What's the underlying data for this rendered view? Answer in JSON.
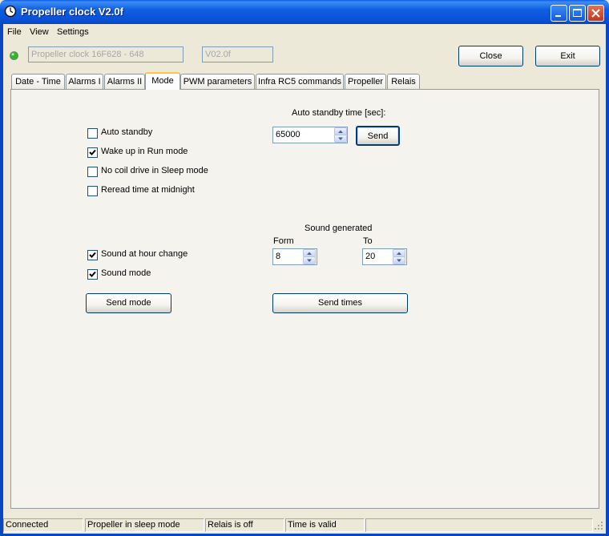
{
  "window": {
    "title": "Propeller clock V2.0f"
  },
  "menu": [
    "File",
    "View",
    "Settings"
  ],
  "header": {
    "status_led_color": "#2fb824",
    "device_field": "Propeller clock 16F628 - 648",
    "version_field": "V02.0f",
    "close_label": "Close",
    "exit_label": "Exit"
  },
  "tabs": [
    "Date - Time",
    "Alarms I",
    "Alarms II",
    "Mode",
    "PWM parameters",
    "Infra RC5 commands",
    "Propeller",
    "Relais"
  ],
  "active_tab": "Mode",
  "mode": {
    "standby_heading": "Auto standby time [sec]:",
    "standby_value": "65000",
    "send_label": "Send",
    "options": [
      {
        "label": "Auto standby",
        "checked": false
      },
      {
        "label": "Wake up in Run mode",
        "checked": true
      },
      {
        "label": "No coil drive in Sleep mode",
        "checked": false
      },
      {
        "label": "Reread time at midnight",
        "checked": false
      }
    ],
    "sound_options": [
      {
        "label": "Sound at hour change",
        "checked": true
      },
      {
        "label": "Sound mode",
        "checked": true
      }
    ],
    "sound_heading": "Sound generated",
    "from_label": "Form",
    "to_label": "To",
    "from_value": "8",
    "to_value": "20",
    "send_mode_label": "Send mode",
    "send_times_label": "Send times"
  },
  "statusbar": [
    "Connected",
    "Propeller in sleep mode",
    "Relais is off",
    "Time is valid",
    ""
  ]
}
